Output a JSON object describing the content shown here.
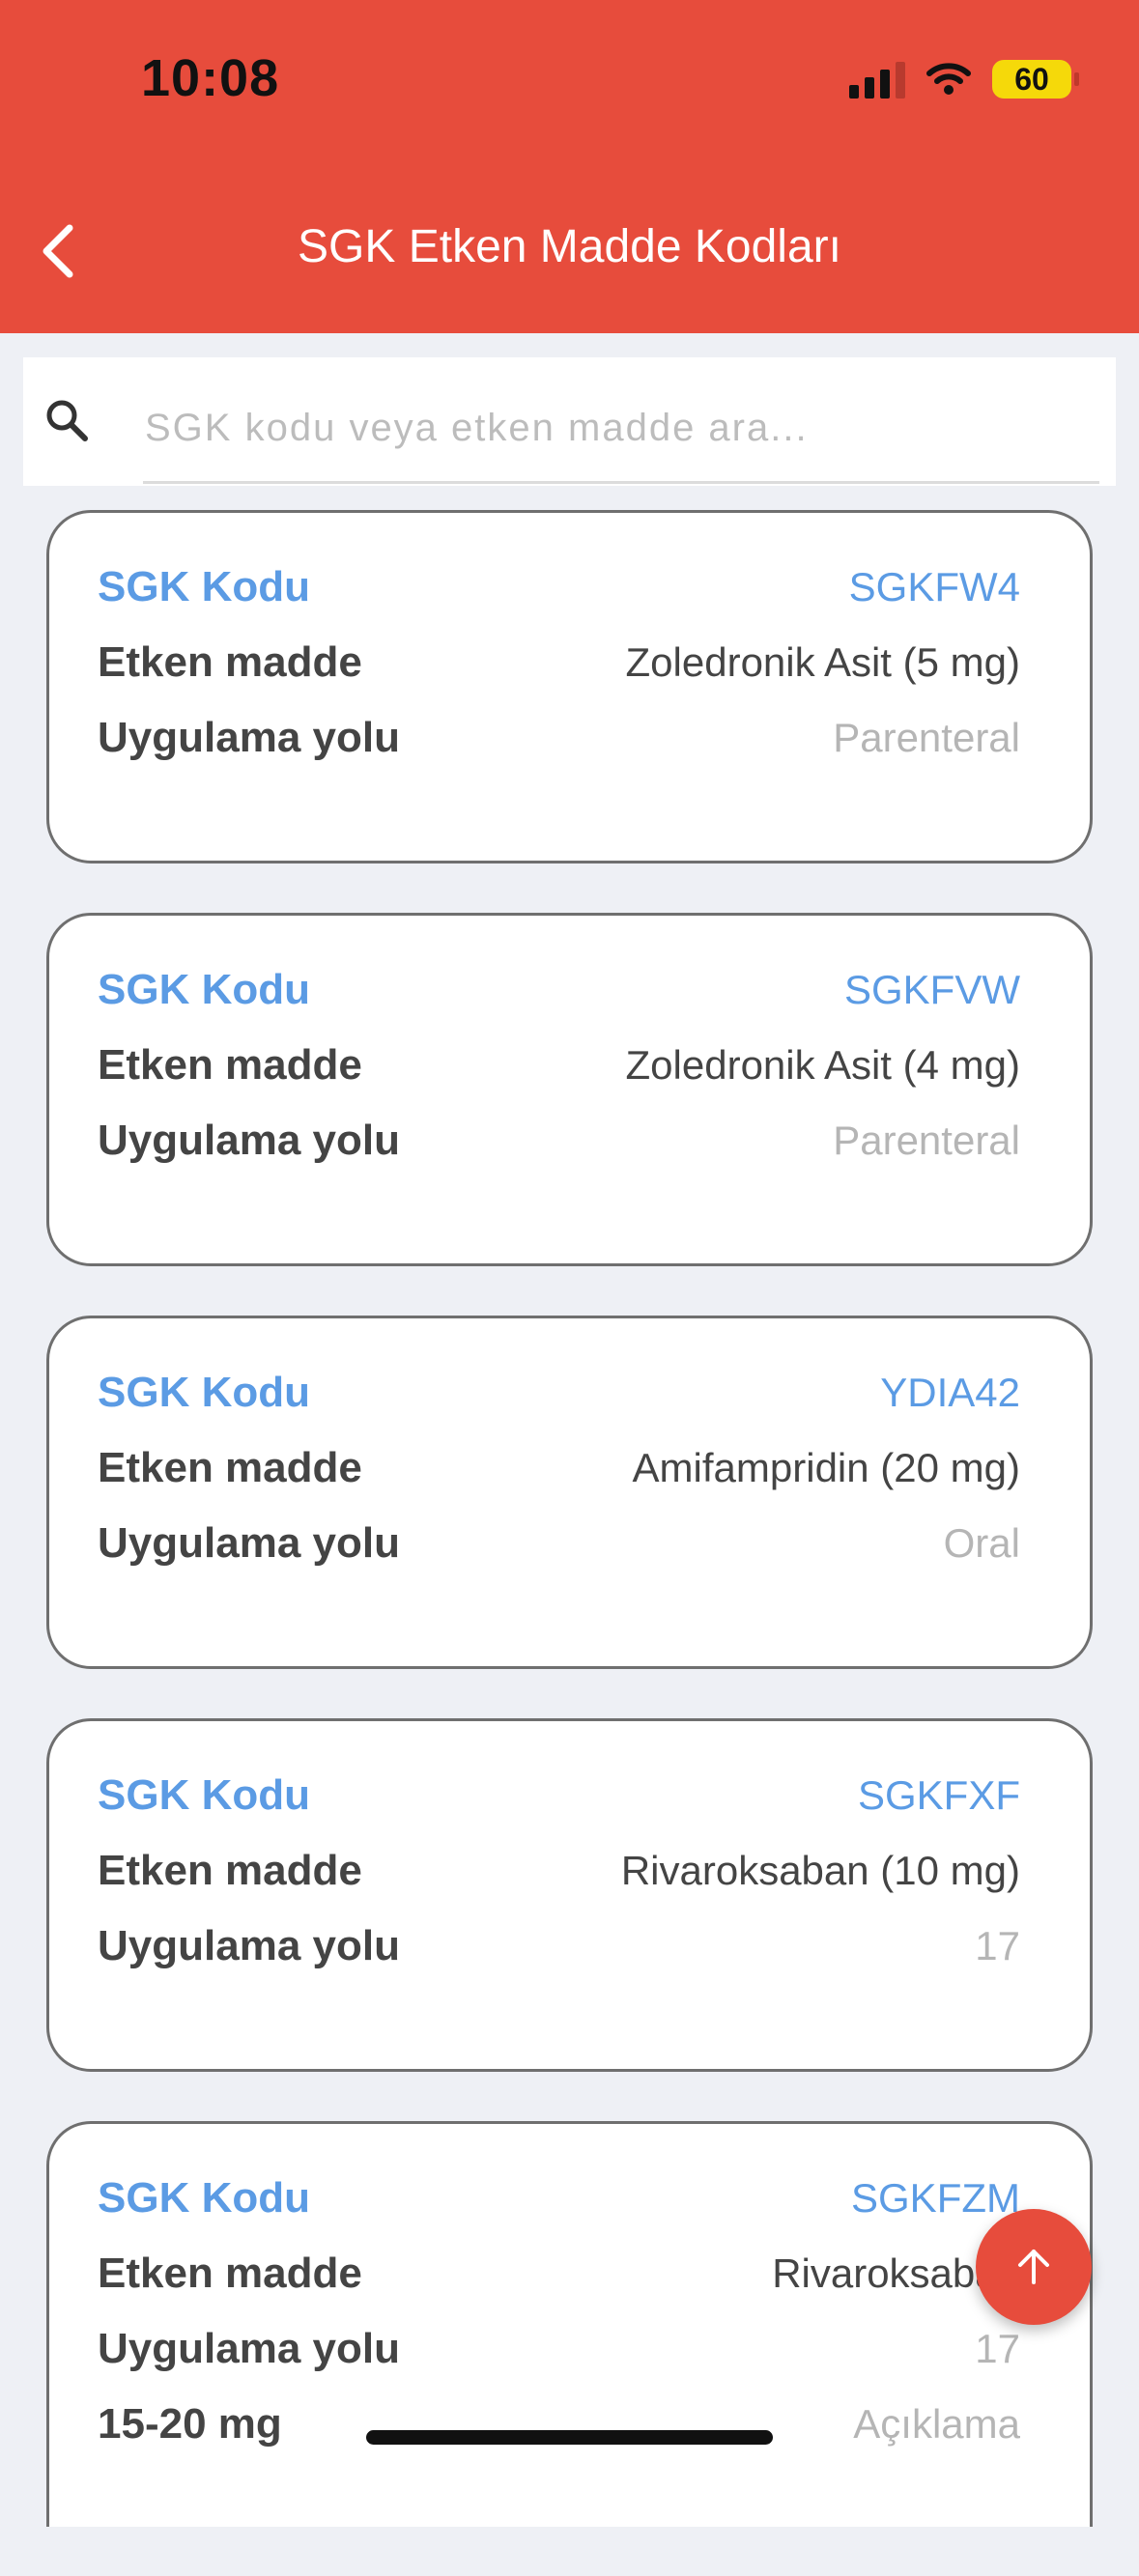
{
  "status_bar": {
    "time": "10:08",
    "battery": "60"
  },
  "header": {
    "title": "SGK Etken Madde Kodları"
  },
  "search": {
    "placeholder": "SGK kodu veya etken madde ara..."
  },
  "cards": [
    {
      "code_label": "SGK Kodu",
      "code": "SGKFW4",
      "ingredient_label": "Etken madde",
      "ingredient": "Zoledronik Asit (5 mg)",
      "route_label": "Uygulama yolu",
      "route": "Parenteral"
    },
    {
      "code_label": "SGK Kodu",
      "code": "SGKFVW",
      "ingredient_label": "Etken madde",
      "ingredient": "Zoledronik Asit (4 mg)",
      "route_label": "Uygulama yolu",
      "route": "Parenteral"
    },
    {
      "code_label": "SGK Kodu",
      "code": "YDIA42",
      "ingredient_label": "Etken madde",
      "ingredient": "Amifampridin (20 mg)",
      "route_label": "Uygulama yolu",
      "route": "Oral"
    },
    {
      "code_label": "SGK Kodu",
      "code": "SGKFXF",
      "ingredient_label": "Etken madde",
      "ingredient": "Rivaroksaban (10 mg)",
      "route_label": "Uygulama yolu",
      "route": "17"
    },
    {
      "code_label": "SGK Kodu",
      "code": "SGKFZM",
      "ingredient_label": "Etken madde",
      "ingredient": "Rivaroksaban",
      "route_label": "Uygulama yolu",
      "route": "17",
      "extra_label": "15-20 mg",
      "extra_value": "Açıklama"
    }
  ],
  "colors": {
    "header": "#e74c3c",
    "code_blue": "#5b9be4",
    "background": "#eef0f5"
  },
  "icons": {
    "back": "chevron-left-icon",
    "search": "search-icon",
    "scroll_top": "arrow-up-icon"
  }
}
